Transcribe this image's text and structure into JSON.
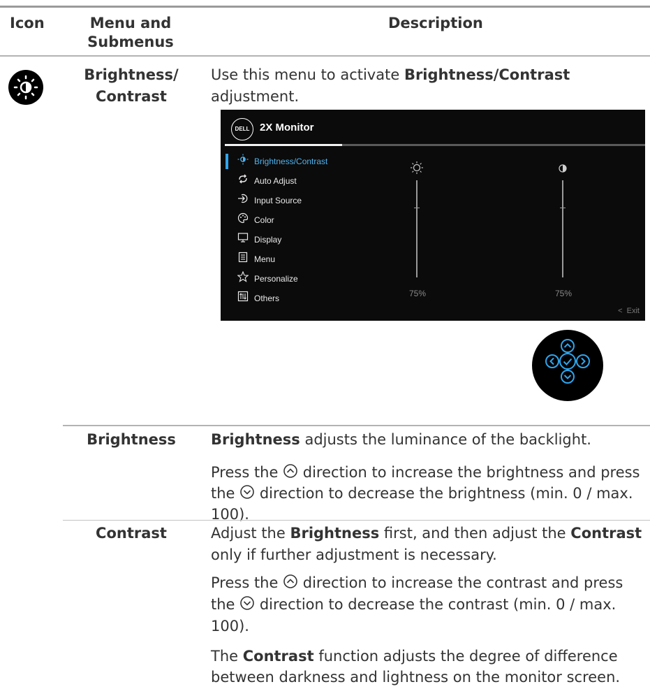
{
  "table": {
    "headers": {
      "icon": "Icon",
      "menu": "Menu and Submenus",
      "description": "Description"
    }
  },
  "rows": {
    "brightness_contrast": {
      "icon": "brightness-contrast-icon",
      "menu_label": "Brightness/ Contrast",
      "desc_prefix": "Use this menu to activate ",
      "desc_bold": "Brightness/Contrast",
      "desc_suffix": " adjustment."
    },
    "brightness": {
      "menu_label": "Brightness",
      "p1_bold": "Brightness",
      "p1_rest": " adjusts the luminance of the backlight.",
      "p2_a": "Press the ",
      "p2_b": " direction to increase the brightness and press the ",
      "p2_c": " direction to decrease the brightness (min. 0 / max. 100)."
    },
    "contrast": {
      "menu_label": "Contrast",
      "p1_a": "Adjust the ",
      "p1_b": "Brightness",
      "p1_c": " first, and then adjust the ",
      "p1_d": "Contrast",
      "p1_e": " only if further adjustment is necessary.",
      "p2_a": "Press the ",
      "p2_b": " direction to increase the contrast and press the ",
      "p2_c": " direction to decrease the contrast (min. 0 / max. 100).",
      "p3_a": "The ",
      "p3_b": "Contrast",
      "p3_c": " function adjusts the degree of difference between darkness and lightness on the monitor screen."
    }
  },
  "osd": {
    "logo": "DELL",
    "title": "2X Monitor",
    "menu_items": [
      {
        "label": "Brightness/Contrast",
        "icon": "sun-icon",
        "selected": true
      },
      {
        "label": "Auto Adjust",
        "icon": "auto-adjust-icon"
      },
      {
        "label": "Input Source",
        "icon": "input-source-icon"
      },
      {
        "label": "Color",
        "icon": "palette-icon"
      },
      {
        "label": "Display",
        "icon": "monitor-icon"
      },
      {
        "label": "Menu",
        "icon": "menu-icon"
      },
      {
        "label": "Personalize",
        "icon": "star-icon"
      },
      {
        "label": "Others",
        "icon": "others-icon"
      }
    ],
    "brightness_value": "75%",
    "contrast_value": "75%",
    "exit_label": "Exit",
    "accent_color": "#2fa5ee"
  },
  "joystick": {
    "accent_color": "#2fa5ee",
    "buttons": [
      "up",
      "left",
      "ok",
      "right",
      "down"
    ]
  }
}
